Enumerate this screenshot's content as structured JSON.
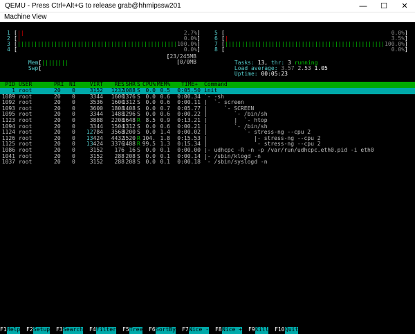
{
  "window": {
    "title": "QEMU - Press Ctrl+Alt+G to release grab@hhmipssw201",
    "minimize_icon": "minimize-icon",
    "maximize_icon": "maximize-icon",
    "close_icon": "close-icon"
  },
  "menu": {
    "items": [
      "Machine",
      "View"
    ]
  },
  "meters": {
    "cpus_left": [
      {
        "n": "1",
        "bar": "||",
        "pct": "2.7%"
      },
      {
        "n": "2",
        "bar": "|",
        "pct": "0.0%"
      },
      {
        "n": "3",
        "bar": "||||||||||||||||||||||||||||||||||||||||||||||||||||||||||||||||||||",
        "pct": "100.0%"
      },
      {
        "n": "4",
        "bar": "",
        "pct": "0.0%"
      }
    ],
    "cpus_right": [
      {
        "n": "5",
        "bar": "",
        "pct": "0.0%"
      },
      {
        "n": "6",
        "bar": "|",
        "pct": "3.5%"
      },
      {
        "n": "7",
        "bar": "||||||||||||||||||||||||||||||||||||||||||||||||||||||||||||",
        "pct": "100.0%"
      },
      {
        "n": "8",
        "bar": "",
        "pct": "0.0%"
      }
    ],
    "mem": {
      "label": "Mem",
      "bar": "||||||||",
      "value": "23/245MB"
    },
    "swp": {
      "label": "Swp",
      "bar": "",
      "value": "0/0MB"
    },
    "tasks_label": "Tasks:",
    "tasks": "13",
    "thr_label": "thr:",
    "thr": "3",
    "running": "running",
    "load_label": "Load average:",
    "load1": "3.57",
    "load5": "2.53",
    "load15": "1.05",
    "uptime_label": "Uptime:",
    "uptime": "00:05:23"
  },
  "table": {
    "columns": [
      "PID",
      "USER",
      "PRI",
      "NI",
      "VIRT",
      "RES",
      "SHR",
      "S",
      "CPU%",
      "MEM%",
      "TIME+",
      "Command"
    ],
    "rows": [
      {
        "pid": "1",
        "user": "root",
        "pri": "20",
        "ni": "0",
        "virt": "3152",
        "res": "1232",
        "shr": "1088",
        "s": "S",
        "cpu": "0.0",
        "mem": "0.5",
        "time": "0:05.50",
        "cmd": "init"
      },
      {
        "pid": "1089",
        "user": "root",
        "pri": "20",
        "ni": "0",
        "virt": "3344",
        "res": "1600",
        "shr": "1376",
        "s": "S",
        "cpu": "0.0",
        "mem": "0.6",
        "time": "0:00.34",
        "cmd": "`- -sh"
      },
      {
        "pid": "1092",
        "user": "root",
        "pri": "20",
        "ni": "0",
        "virt": "3536",
        "res": "1600",
        "shr": "1312",
        "s": "S",
        "cpu": "0.0",
        "mem": "0.6",
        "time": "0:00.11",
        "cmd": "|  `- screen"
      },
      {
        "pid": "1093",
        "user": "root",
        "pri": "20",
        "ni": "0",
        "virt": "3600",
        "res": "1808",
        "shr": "1408",
        "s": "S",
        "cpu": "0.0",
        "mem": "0.7",
        "time": "0:05.77",
        "cmd": "|     `- SCREEN"
      },
      {
        "pid": "1095",
        "user": "root",
        "pri": "20",
        "ni": "0",
        "virt": "3344",
        "res": "1488",
        "shr": "1296",
        "s": "S",
        "cpu": "0.0",
        "mem": "0.6",
        "time": "0:00.22",
        "cmd": "|        `- /bin/sh"
      },
      {
        "pid": "1123",
        "user": "root",
        "pri": "20",
        "ni": "0",
        "virt": "3888",
        "res": "2208",
        "shr": "1648",
        "s": "R",
        "cpu": "8.5",
        "mem": "0.9",
        "time": "0:13.21",
        "cmd": "|        |  `- htop"
      },
      {
        "pid": "1094",
        "user": "root",
        "pri": "20",
        "ni": "0",
        "virt": "3344",
        "res": "1504",
        "shr": "1312",
        "s": "S",
        "cpu": "0.0",
        "mem": "0.6",
        "time": "0:00.21",
        "cmd": "|        `- /bin/sh"
      },
      {
        "pid": "1124",
        "user": "root",
        "pri": "20",
        "ni": "0",
        "virt": "12784",
        "res": "3568",
        "shr": "3200",
        "s": "S",
        "cpu": "0.0",
        "mem": "1.4",
        "time": "0:00.02",
        "cmd": "|           `- stress-ng --cpu 2"
      },
      {
        "pid": "1126",
        "user": "root",
        "pri": "20",
        "ni": "0",
        "virt": "13424",
        "res": "4432",
        "shr": "1520",
        "s": "R",
        "cpu": "104.",
        "mem": "1.8",
        "time": "0:15.53",
        "cmd": "|              |- stress-ng --cpu 2"
      },
      {
        "pid": "1125",
        "user": "root",
        "pri": "20",
        "ni": "0",
        "virt": "13424",
        "res": "3376",
        "shr": "1488",
        "s": "R",
        "cpu": "99.5",
        "mem": "1.3",
        "time": "0:15.34",
        "cmd": "|              `- stress-ng --cpu 2"
      },
      {
        "pid": "1086",
        "user": "root",
        "pri": "20",
        "ni": "0",
        "virt": "3152",
        "res": "176",
        "shr": "16",
        "s": "S",
        "cpu": "0.0",
        "mem": "0.1",
        "time": "0:00.00",
        "cmd": "|- udhcpc -R -n -p /var/run/udhcpc.eth0.pid -i eth0"
      },
      {
        "pid": "1041",
        "user": "root",
        "pri": "20",
        "ni": "0",
        "virt": "3152",
        "res": "288",
        "shr": "208",
        "s": "S",
        "cpu": "0.0",
        "mem": "0.1",
        "time": "0:00.14",
        "cmd": "|- /sbin/klogd -n"
      },
      {
        "pid": "1037",
        "user": "root",
        "pri": "20",
        "ni": "0",
        "virt": "3152",
        "res": "288",
        "shr": "208",
        "s": "S",
        "cpu": "0.0",
        "mem": "0.1",
        "time": "0:00.18",
        "cmd": "`- /sbin/syslogd -n"
      }
    ]
  },
  "fkeys": [
    {
      "key": "F1",
      "label": "Help"
    },
    {
      "key": "F2",
      "label": "Setup"
    },
    {
      "key": "F3",
      "label": "Search"
    },
    {
      "key": "F4",
      "label": "Filter"
    },
    {
      "key": "F5",
      "label": "Tree"
    },
    {
      "key": "F6",
      "label": "SortBy"
    },
    {
      "key": "F7",
      "label": "Nice -"
    },
    {
      "key": "F8",
      "label": "Nice +"
    },
    {
      "key": "F9",
      "label": "Kill"
    },
    {
      "key": "F10",
      "label": "Quit"
    }
  ]
}
